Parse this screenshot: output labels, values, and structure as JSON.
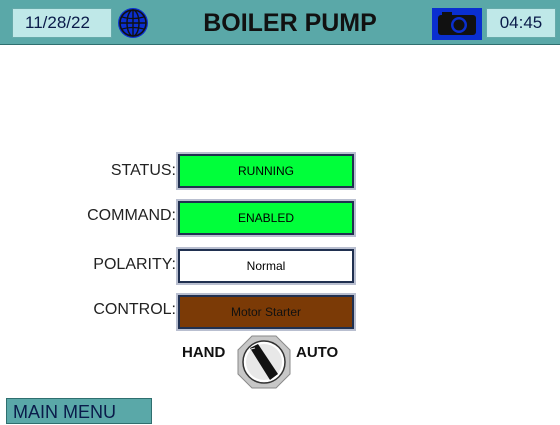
{
  "header": {
    "date": "11/28/22",
    "title": "BOILER PUMP",
    "time": "04:45",
    "globe_icon": "globe-icon",
    "camera_icon": "camera-icon"
  },
  "fields": {
    "status": {
      "label": "STATUS:",
      "value": "RUNNING",
      "color": "#00ff3a"
    },
    "command": {
      "label": "COMMAND:",
      "value": "ENABLED",
      "color": "#00ff3a"
    },
    "polarity": {
      "label": "POLARITY:",
      "value": "Normal",
      "color": "#ffffff"
    },
    "control": {
      "label": "CONTROL:",
      "value": "Motor Starter",
      "color": "#7b3a06"
    }
  },
  "selector": {
    "left_label": "HAND",
    "right_label": "AUTO"
  },
  "footer": {
    "main_menu_label": "MAIN MENU"
  }
}
